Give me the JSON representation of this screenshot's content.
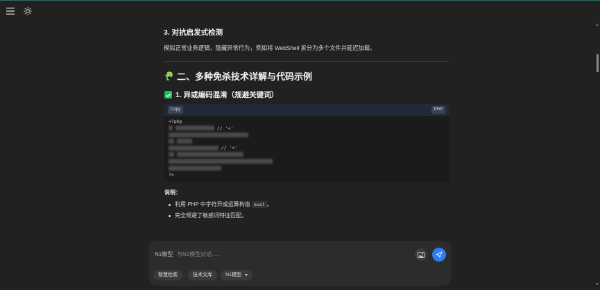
{
  "topbar": {
    "menu_icon": "hamburger-menu-icon",
    "theme_icon": "sun-icon"
  },
  "article": {
    "section3_title": "3. 对抗启发式检测",
    "section3_text": "模拟正常业务逻辑，隐藏异常行为，例如将 WebShell 拆分为多个文件并延迟加载。",
    "section2_emoji": "puzzle-piece-icon",
    "section2_title": "二、多种免杀技术详解与代码示例",
    "subsection1_icon": "check-mark-button-icon",
    "subsection1_title": "1. 异或编码混淆（规避关键词）",
    "code_block": {
      "copy_label": "Copy",
      "language": "PHP",
      "first_line": "<?php",
      "comment_a": "// '<'",
      "comment_b": "// '>'",
      "last_line": "?>"
    },
    "note_label": "说明：",
    "bullets": [
      {
        "before": "利用 PHP 中字符异或运算构造 ",
        "code": "eval",
        "after": "。"
      },
      {
        "before": "完全规避了敏感词特征匹配。",
        "code": "",
        "after": ""
      }
    ]
  },
  "composer": {
    "model_prefix": "N1模型",
    "placeholder": "与N1模型对话......",
    "chips": [
      "智慧检索",
      "技术文库",
      "N1模型"
    ],
    "image_icon": "image-upload-icon",
    "send_icon": "send-icon"
  },
  "colors": {
    "background": "#212121",
    "send_button": "#2f7cf6",
    "check_green": "#1fbe5a",
    "code_header": "#222a3a"
  }
}
